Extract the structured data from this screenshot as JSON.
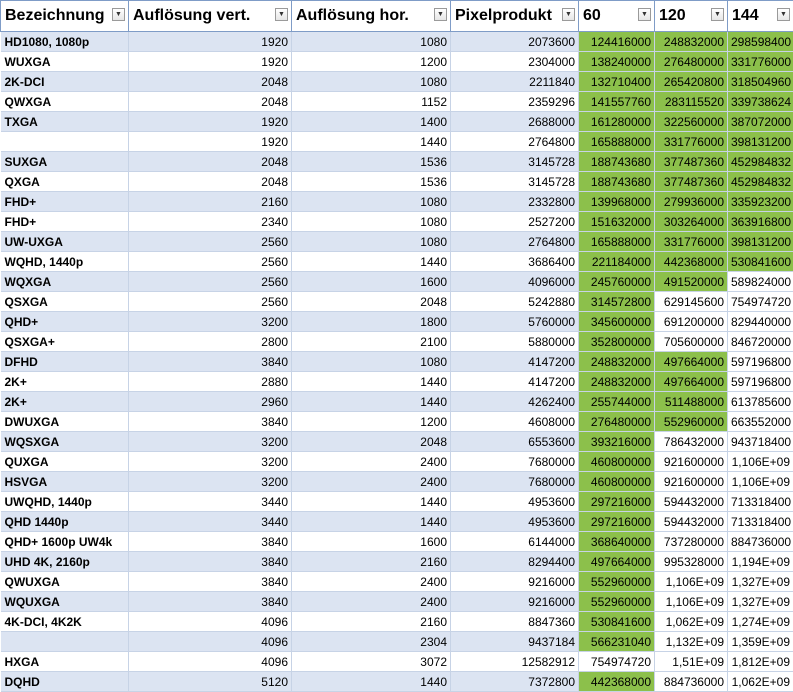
{
  "headers": [
    "Bezeichnung",
    "Auflösung vert.",
    "Auflösung hor.",
    "Pixelprodukt",
    "60",
    "120",
    "144"
  ],
  "filter_icon": "chevron-down-icon",
  "colors": {
    "green": "#8cc04b",
    "band": "#dce4f2",
    "header_border": "#7f9cc7"
  },
  "rows": [
    {
      "name": "HD1080, 1080p",
      "v": "1920",
      "h": "1080",
      "p": "2073600",
      "f60": "124416000",
      "f120": "248832000",
      "f144": "298598400",
      "g": [
        1,
        1,
        1
      ]
    },
    {
      "name": "WUXGA",
      "v": "1920",
      "h": "1200",
      "p": "2304000",
      "f60": "138240000",
      "f120": "276480000",
      "f144": "331776000",
      "g": [
        1,
        1,
        1
      ]
    },
    {
      "name": "2K-DCI",
      "v": "2048",
      "h": "1080",
      "p": "2211840",
      "f60": "132710400",
      "f120": "265420800",
      "f144": "318504960",
      "g": [
        1,
        1,
        1
      ]
    },
    {
      "name": "QWXGA",
      "v": "2048",
      "h": "1152",
      "p": "2359296",
      "f60": "141557760",
      "f120": "283115520",
      "f144": "339738624",
      "g": [
        1,
        1,
        1
      ]
    },
    {
      "name": "TXGA",
      "v": "1920",
      "h": "1400",
      "p": "2688000",
      "f60": "161280000",
      "f120": "322560000",
      "f144": "387072000",
      "g": [
        1,
        1,
        1
      ]
    },
    {
      "name": "",
      "v": "1920",
      "h": "1440",
      "p": "2764800",
      "f60": "165888000",
      "f120": "331776000",
      "f144": "398131200",
      "g": [
        1,
        1,
        1
      ]
    },
    {
      "name": "SUXGA",
      "v": "2048",
      "h": "1536",
      "p": "3145728",
      "f60": "188743680",
      "f120": "377487360",
      "f144": "452984832",
      "g": [
        1,
        1,
        1
      ]
    },
    {
      "name": "QXGA",
      "v": "2048",
      "h": "1536",
      "p": "3145728",
      "f60": "188743680",
      "f120": "377487360",
      "f144": "452984832",
      "g": [
        1,
        1,
        1
      ]
    },
    {
      "name": "FHD+",
      "v": "2160",
      "h": "1080",
      "p": "2332800",
      "f60": "139968000",
      "f120": "279936000",
      "f144": "335923200",
      "g": [
        1,
        1,
        1
      ]
    },
    {
      "name": "FHD+",
      "v": "2340",
      "h": "1080",
      "p": "2527200",
      "f60": "151632000",
      "f120": "303264000",
      "f144": "363916800",
      "g": [
        1,
        1,
        1
      ]
    },
    {
      "name": "UW-UXGA",
      "v": "2560",
      "h": "1080",
      "p": "2764800",
      "f60": "165888000",
      "f120": "331776000",
      "f144": "398131200",
      "g": [
        1,
        1,
        1
      ]
    },
    {
      "name": "WQHD, 1440p",
      "v": "2560",
      "h": "1440",
      "p": "3686400",
      "f60": "221184000",
      "f120": "442368000",
      "f144": "530841600",
      "g": [
        1,
        1,
        1
      ]
    },
    {
      "name": "WQXGA",
      "v": "2560",
      "h": "1600",
      "p": "4096000",
      "f60": "245760000",
      "f120": "491520000",
      "f144": "589824000",
      "g": [
        1,
        1,
        0
      ]
    },
    {
      "name": "QSXGA",
      "v": "2560",
      "h": "2048",
      "p": "5242880",
      "f60": "314572800",
      "f120": "629145600",
      "f144": "754974720",
      "g": [
        1,
        0,
        0
      ]
    },
    {
      "name": "QHD+",
      "v": "3200",
      "h": "1800",
      "p": "5760000",
      "f60": "345600000",
      "f120": "691200000",
      "f144": "829440000",
      "g": [
        1,
        0,
        0
      ]
    },
    {
      "name": "QSXGA+",
      "v": "2800",
      "h": "2100",
      "p": "5880000",
      "f60": "352800000",
      "f120": "705600000",
      "f144": "846720000",
      "g": [
        1,
        0,
        0
      ]
    },
    {
      "name": "DFHD",
      "v": "3840",
      "h": "1080",
      "p": "4147200",
      "f60": "248832000",
      "f120": "497664000",
      "f144": "597196800",
      "g": [
        1,
        1,
        0
      ]
    },
    {
      "name": "2K+",
      "v": "2880",
      "h": "1440",
      "p": "4147200",
      "f60": "248832000",
      "f120": "497664000",
      "f144": "597196800",
      "g": [
        1,
        1,
        0
      ]
    },
    {
      "name": "2K+",
      "v": "2960",
      "h": "1440",
      "p": "4262400",
      "f60": "255744000",
      "f120": "511488000",
      "f144": "613785600",
      "g": [
        1,
        1,
        0
      ]
    },
    {
      "name": "DWUXGA",
      "v": "3840",
      "h": "1200",
      "p": "4608000",
      "f60": "276480000",
      "f120": "552960000",
      "f144": "663552000",
      "g": [
        1,
        1,
        0
      ]
    },
    {
      "name": "WQSXGA",
      "v": "3200",
      "h": "2048",
      "p": "6553600",
      "f60": "393216000",
      "f120": "786432000",
      "f144": "943718400",
      "g": [
        1,
        0,
        0
      ]
    },
    {
      "name": "QUXGA",
      "v": "3200",
      "h": "2400",
      "p": "7680000",
      "f60": "460800000",
      "f120": "921600000",
      "f144": "1,106E+09",
      "g": [
        1,
        0,
        0
      ]
    },
    {
      "name": "HSVGA",
      "v": "3200",
      "h": "2400",
      "p": "7680000",
      "f60": "460800000",
      "f120": "921600000",
      "f144": "1,106E+09",
      "g": [
        1,
        0,
        0
      ]
    },
    {
      "name": "UWQHD, 1440p",
      "v": "3440",
      "h": "1440",
      "p": "4953600",
      "f60": "297216000",
      "f120": "594432000",
      "f144": "713318400",
      "g": [
        1,
        0,
        0
      ]
    },
    {
      "name": "QHD 1440p",
      "v": "3440",
      "h": "1440",
      "p": "4953600",
      "f60": "297216000",
      "f120": "594432000",
      "f144": "713318400",
      "g": [
        1,
        0,
        0
      ]
    },
    {
      "name": "QHD+ 1600p UW4k",
      "v": "3840",
      "h": "1600",
      "p": "6144000",
      "f60": "368640000",
      "f120": "737280000",
      "f144": "884736000",
      "g": [
        1,
        0,
        0
      ]
    },
    {
      "name": "UHD 4K, 2160p",
      "v": "3840",
      "h": "2160",
      "p": "8294400",
      "f60": "497664000",
      "f120": "995328000",
      "f144": "1,194E+09",
      "g": [
        1,
        0,
        0
      ]
    },
    {
      "name": "QWUXGA",
      "v": "3840",
      "h": "2400",
      "p": "9216000",
      "f60": "552960000",
      "f120": "1,106E+09",
      "f144": "1,327E+09",
      "g": [
        1,
        0,
        0
      ]
    },
    {
      "name": "WQUXGA",
      "v": "3840",
      "h": "2400",
      "p": "9216000",
      "f60": "552960000",
      "f120": "1,106E+09",
      "f144": "1,327E+09",
      "g": [
        1,
        0,
        0
      ]
    },
    {
      "name": "4K-DCI, 4K2K",
      "v": "4096",
      "h": "2160",
      "p": "8847360",
      "f60": "530841600",
      "f120": "1,062E+09",
      "f144": "1,274E+09",
      "g": [
        1,
        0,
        0
      ]
    },
    {
      "name": "",
      "v": "4096",
      "h": "2304",
      "p": "9437184",
      "f60": "566231040",
      "f120": "1,132E+09",
      "f144": "1,359E+09",
      "g": [
        1,
        0,
        0
      ]
    },
    {
      "name": "HXGA",
      "v": "4096",
      "h": "3072",
      "p": "12582912",
      "f60": "754974720",
      "f120": "1,51E+09",
      "f144": "1,812E+09",
      "g": [
        0,
        0,
        0
      ]
    },
    {
      "name": "DQHD",
      "v": "5120",
      "h": "1440",
      "p": "7372800",
      "f60": "442368000",
      "f120": "884736000",
      "f144": "1,062E+09",
      "g": [
        1,
        0,
        0
      ]
    }
  ]
}
